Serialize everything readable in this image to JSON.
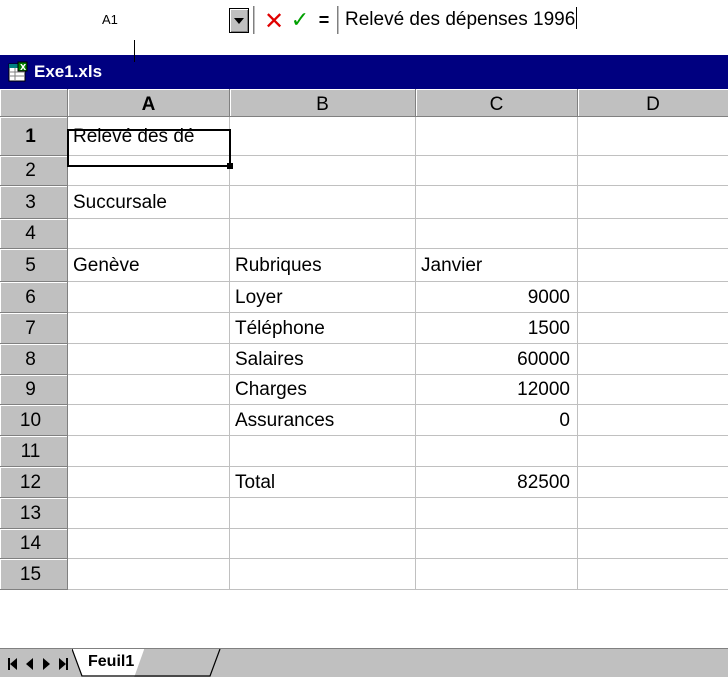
{
  "formula_bar": {
    "cell_ref": "A1",
    "cancel_symbol": "✕",
    "enter_symbol": "✓",
    "equals_symbol": "=",
    "content": "Relevé des dépenses 1996"
  },
  "window": {
    "title": "Exe1.xls"
  },
  "columns": [
    "A",
    "B",
    "C",
    "D"
  ],
  "rows": [
    {
      "num": "1",
      "a": "Relevé des dé",
      "b": "",
      "c": "",
      "d": ""
    },
    {
      "num": "2",
      "a": "",
      "b": "",
      "c": "",
      "d": ""
    },
    {
      "num": "3",
      "a": "Succursale",
      "b": "",
      "c": "",
      "d": ""
    },
    {
      "num": "4",
      "a": "",
      "b": "",
      "c": "",
      "d": ""
    },
    {
      "num": "5",
      "a": "Genève",
      "b": "Rubriques",
      "c": "Janvier",
      "d": ""
    },
    {
      "num": "6",
      "a": "",
      "b": "Loyer",
      "c": "9000",
      "d": ""
    },
    {
      "num": "7",
      "a": "",
      "b": "Téléphone",
      "c": "1500",
      "d": ""
    },
    {
      "num": "8",
      "a": "",
      "b": "Salaires",
      "c": "60000",
      "d": ""
    },
    {
      "num": "9",
      "a": "",
      "b": "Charges",
      "c": "12000",
      "d": ""
    },
    {
      "num": "10",
      "a": "",
      "b": "Assurances",
      "c": "0",
      "d": ""
    },
    {
      "num": "11",
      "a": "",
      "b": "",
      "c": "",
      "d": ""
    },
    {
      "num": "12",
      "a": "",
      "b": "Total",
      "c": "82500",
      "d": ""
    },
    {
      "num": "13",
      "a": "",
      "b": "",
      "c": "",
      "d": ""
    },
    {
      "num": "14",
      "a": "",
      "b": "",
      "c": "",
      "d": ""
    },
    {
      "num": "15",
      "a": "",
      "b": "",
      "c": "",
      "d": ""
    }
  ],
  "sheet_tabs": [
    "Feuil1"
  ],
  "colors": {
    "title_bar": "#000080",
    "cancel": "#e00000",
    "enter": "#00a000",
    "chrome": "#c0c0c0"
  },
  "icons": {
    "workbook": "excel-workbook-icon",
    "dropdown": "chevron-down-icon",
    "cancel": "close-icon",
    "enter": "checkmark-icon",
    "first_sheet": "first-sheet-icon",
    "prev_sheet": "previous-sheet-icon",
    "next_sheet": "next-sheet-icon",
    "last_sheet": "last-sheet-icon"
  }
}
